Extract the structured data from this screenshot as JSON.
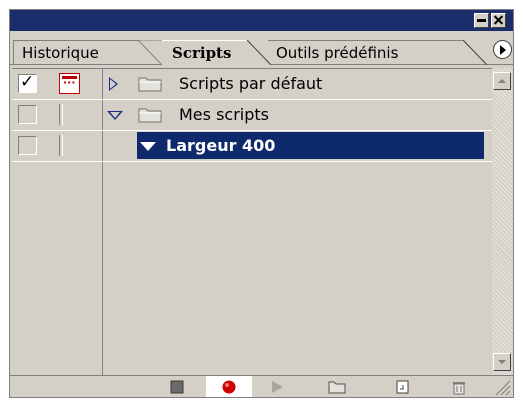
{
  "window": {
    "minimize_icon": "minimize-icon",
    "close_icon": "close-icon"
  },
  "tabs": [
    {
      "label": "Historique",
      "active": false
    },
    {
      "label": "Scripts",
      "active": true
    },
    {
      "label": "Outils prédéfinis",
      "active": false
    }
  ],
  "panel_menu_icon": "play-circle-icon",
  "actions": [
    {
      "label": "Scripts par défaut",
      "type": "set",
      "expanded": false,
      "checked": true,
      "dialog": true,
      "selected": false
    },
    {
      "label": "Mes scripts",
      "type": "set",
      "expanded": true,
      "checked": false,
      "dialog": false,
      "selected": false
    },
    {
      "label": "Largeur 400",
      "type": "action",
      "expanded": true,
      "checked": false,
      "dialog": false,
      "selected": true
    }
  ],
  "toolbar": [
    {
      "name": "stop-button",
      "icon": "stop-icon"
    },
    {
      "name": "record-button",
      "icon": "record-icon"
    },
    {
      "name": "play-button",
      "icon": "play-icon"
    },
    {
      "name": "new-set-button",
      "icon": "folder-icon"
    },
    {
      "name": "new-action-button",
      "icon": "new-page-icon"
    },
    {
      "name": "delete-button",
      "icon": "trash-icon"
    }
  ],
  "colors": {
    "titlebar": "#1c2d6b",
    "selection": "#0f2a6c",
    "panel": "#d4d0c8",
    "record": "#d00000",
    "dialog_toggle": "#c00000"
  }
}
